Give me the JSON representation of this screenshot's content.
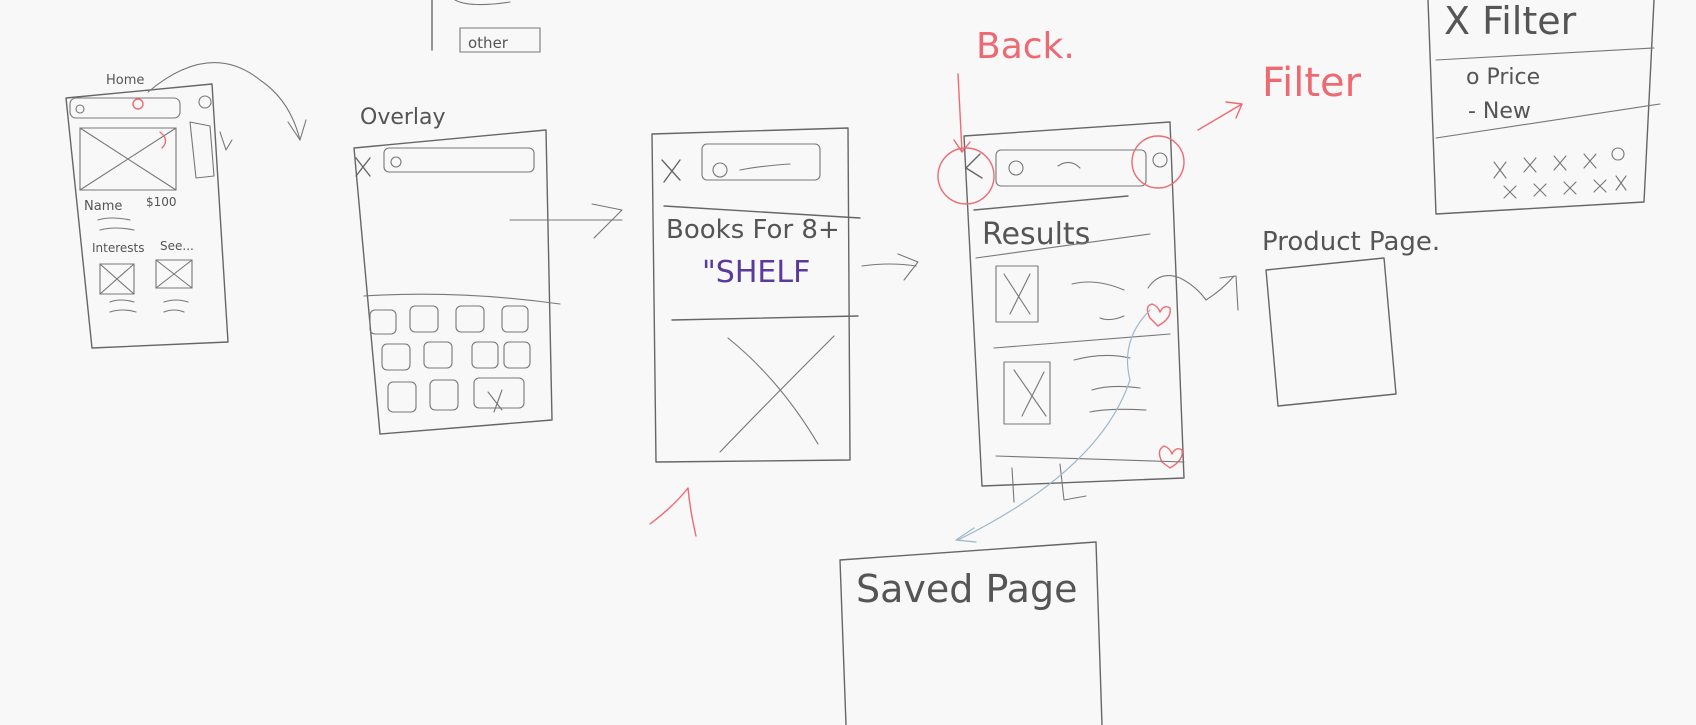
{
  "board": {
    "ink_colors": {
      "pencil": "#666666",
      "red": "#ee6a72",
      "purple": "#5a3a9a",
      "blue": "#9bb8cc"
    }
  },
  "top_fragment": {
    "label": "other"
  },
  "home": {
    "title": "Home",
    "name_label": "Name",
    "price_label": "$100",
    "interests_label": "Interests",
    "see_label": "See..."
  },
  "overlay": {
    "title": "Overlay"
  },
  "shelf": {
    "line1": "Books For 8+",
    "line2": "\"SHELF"
  },
  "results": {
    "back_note": "Back.",
    "filter_note": "Filter",
    "title": "Results"
  },
  "filter_panel": {
    "title": "X Filter",
    "option1": "o Price",
    "option2": "- New"
  },
  "product": {
    "title": "Product Page."
  },
  "saved": {
    "title": "Saved Page"
  }
}
